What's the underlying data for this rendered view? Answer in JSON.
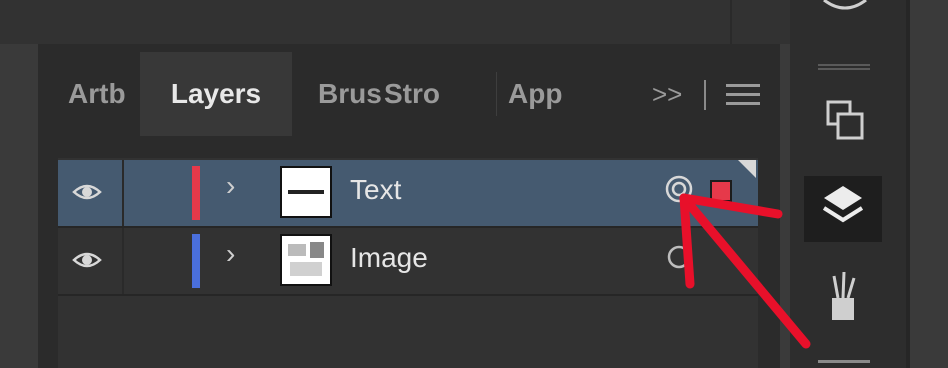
{
  "panel": {
    "tabs": [
      {
        "id": "artboards",
        "label": "Artb"
      },
      {
        "id": "layers",
        "label": "Layers",
        "active": true
      },
      {
        "id": "brushes",
        "label": "Brus"
      },
      {
        "id": "stroke",
        "label": "Stro"
      },
      {
        "id": "appearance",
        "label": "App"
      }
    ],
    "overflow_label": ">>",
    "menu_icon": "hamburger-menu-icon"
  },
  "layers": [
    {
      "name": "Text",
      "color": "#e6394a",
      "selected": true,
      "visible": true
    },
    {
      "name": "Image",
      "color": "#4a6fdc",
      "selected": false,
      "visible": true
    }
  ],
  "dock": {
    "icons": [
      "artboards-icon",
      "layers-icon",
      "brushes-icon"
    ]
  },
  "colors": {
    "selection_row": "#455a70",
    "annotation_arrow": "#e8102a"
  }
}
